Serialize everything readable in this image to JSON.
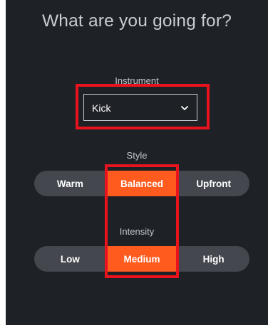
{
  "header": {
    "title": "What are you going for?"
  },
  "instrument": {
    "label": "Instrument",
    "selected": "Kick",
    "icon": "chevron-down-icon"
  },
  "style": {
    "label": "Style",
    "options": [
      "Warm",
      "Balanced",
      "Upfront"
    ],
    "selected": "Balanced"
  },
  "intensity": {
    "label": "Intensity",
    "options": [
      "Low",
      "Medium",
      "High"
    ],
    "selected": "Medium"
  },
  "colors": {
    "background": "#1e2125",
    "segment_track": "#44484e",
    "accent": "#ff5b1f",
    "highlight_outline": "#e8131c"
  }
}
